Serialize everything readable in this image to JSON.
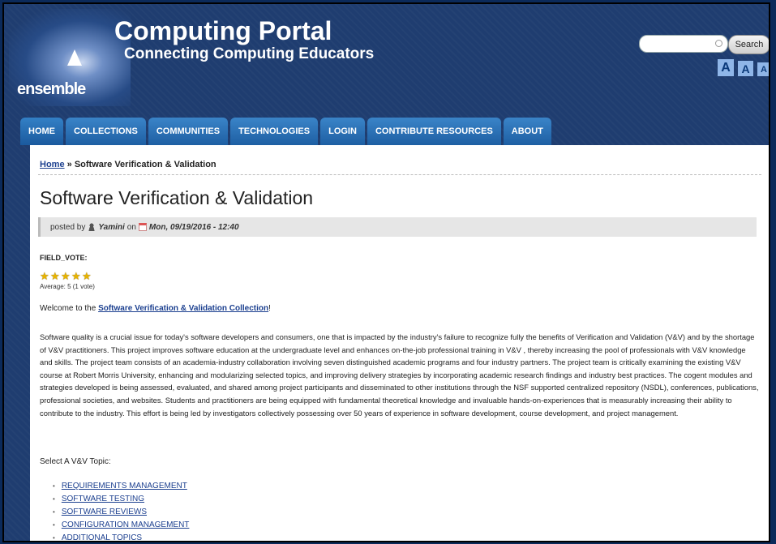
{
  "header": {
    "logo_text": "ensemble",
    "site_title": "Computing Portal",
    "site_slogan": "Connecting Computing Educators",
    "search_placeholder": "",
    "search_button": "Search",
    "font_size_buttons": [
      "A",
      "A",
      "A"
    ]
  },
  "nav": {
    "tabs": [
      "HOME",
      "COLLECTIONS",
      "COMMUNITIES",
      "TECHNOLOGIES",
      "LOGIN",
      "CONTRIBUTE RESOURCES",
      "ABOUT"
    ]
  },
  "breadcrumb": {
    "home": "Home",
    "separator": "»",
    "current": "Software Verification & Validation"
  },
  "page": {
    "title": "Software Verification & Validation",
    "posted_by_label": "posted by",
    "author": "Yamini",
    "on_label": "on",
    "date": "Mon, 09/19/2016 - 12:40",
    "field_vote_label": "FIELD_VOTE:",
    "rating_stars": 5,
    "rating_text": "Average: 5 (1 vote)",
    "welcome_prefix": "Welcome to the",
    "welcome_link": "Software Verification & Validation Collection",
    "welcome_suffix": "!",
    "paragraph": "Software quality is a crucial issue for today's software developers and consumers, one that is impacted by the industry's failure to recognize fully the benefits of Verification and Validation (V&V) and by the shortage of V&V practitioners. This project improves software education at the undergraduate level and enhances on-the-job professional training in V&V , thereby increasing the pool of professionals with V&V knowledge and skills. The project team consists of an academia-industry collaboration involving seven distinguished academic programs and four industry partners. The project team is critically examining the existing V&V course at Robert Morris University, enhancing and modularizing selected topics, and improving delivery strategies by incorporating academic research findings and industry best practices. The cogent modules and strategies developed is being assessed, evaluated, and shared among project participants and disseminated to other institutions through the NSF supported centralized repository (NSDL), conferences, publications, professional societies, and websites. Students and practitioners are being equipped with fundamental theoretical knowledge and invaluable hands-on-experiences that is measurably increasing their ability to contribute to the industry. This effort is being led by investigators collectively possessing over 50 years of experience in software development, course development, and project management.",
    "topic_label": "Select A V&V Topic:",
    "topics": [
      "REQUIREMENTS MANAGEMENT",
      "SOFTWARE TESTING",
      "SOFTWARE REVIEWS",
      "CONFIGURATION MANAGEMENT",
      "ADDITIONAL TOPICS"
    ]
  },
  "colors": {
    "header_bg": "#1f3d70",
    "tab_bg": "#2a72b8",
    "link": "#1b3f8f",
    "star": "#e7b300"
  }
}
